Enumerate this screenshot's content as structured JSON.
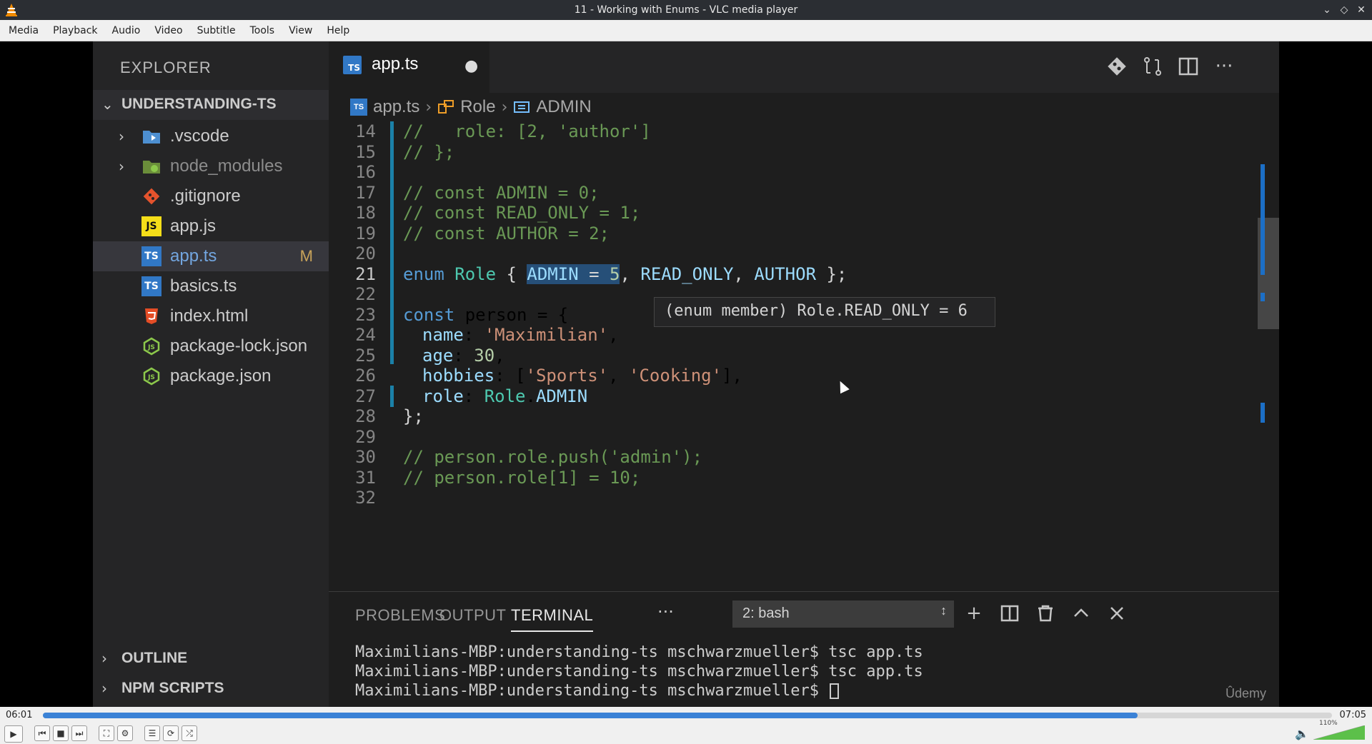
{
  "window": {
    "title": "11 - Working with Enums - VLC media player"
  },
  "menu": [
    "Media",
    "Playback",
    "Audio",
    "Video",
    "Subtitle",
    "Tools",
    "View",
    "Help"
  ],
  "explorer": {
    "title": "EXPLORER",
    "project": "UNDERSTANDING-TS",
    "items": [
      {
        "label": ".vscode",
        "icon": "vscode-folder-icon",
        "folder": true
      },
      {
        "label": "node_modules",
        "icon": "node-folder-icon",
        "folder": true
      },
      {
        "label": ".gitignore",
        "icon": "git-icon",
        "folder": false
      },
      {
        "label": "app.js",
        "icon": "js-icon",
        "folder": false
      },
      {
        "label": "app.ts",
        "icon": "ts-icon",
        "folder": false,
        "badge": "M"
      },
      {
        "label": "basics.ts",
        "icon": "ts-icon",
        "folder": false
      },
      {
        "label": "index.html",
        "icon": "html5-icon",
        "folder": false
      },
      {
        "label": "package-lock.json",
        "icon": "node-icon",
        "folder": false
      },
      {
        "label": "package.json",
        "icon": "node-icon",
        "folder": false
      }
    ],
    "outline": "OUTLINE",
    "npm_scripts": "NPM SCRIPTS"
  },
  "editor": {
    "tab": {
      "label": "app.ts",
      "icon_text": "TS"
    },
    "breadcrumb": [
      "app.ts",
      "Role",
      "ADMIN"
    ],
    "current_line": 21,
    "lines": [
      {
        "n": "14",
        "text": "//   role: [2, 'author']"
      },
      {
        "n": "15",
        "text": "// };"
      },
      {
        "n": "16",
        "text": ""
      },
      {
        "n": "17",
        "text": "// const ADMIN = 0;"
      },
      {
        "n": "18",
        "text": "// const READ_ONLY = 1;"
      },
      {
        "n": "19",
        "text": "// const AUTHOR = 2;"
      },
      {
        "n": "20",
        "text": ""
      },
      {
        "n": "21",
        "text": "enum Role { ADMIN = 5, READ_ONLY, AUTHOR };"
      },
      {
        "n": "22",
        "text": ""
      },
      {
        "n": "23",
        "text": "const person = {"
      },
      {
        "n": "24",
        "text": "name: 'Maximilian',"
      },
      {
        "n": "25",
        "text": "age: 30,"
      },
      {
        "n": "26",
        "text": "hobbies: ['Sports', 'Cooking'],"
      },
      {
        "n": "27",
        "text": "role: Role.ADMIN"
      },
      {
        "n": "28",
        "text": "};"
      },
      {
        "n": "29",
        "text": ""
      },
      {
        "n": "30",
        "text": "// person.role.push('admin');"
      },
      {
        "n": "31",
        "text": "// person.role[1] = 10;"
      },
      {
        "n": "32",
        "text": ""
      }
    ],
    "hover": "(enum member) Role.READ_ONLY = 6"
  },
  "panel": {
    "tabs": [
      "PROBLEMS",
      "OUTPUT",
      "TERMINAL"
    ],
    "active_tab": "TERMINAL",
    "terminal_select": "2: bash",
    "terminal_lines": [
      "Maximilians-MBP:understanding-ts mschwarzmueller$ tsc app.ts",
      "Maximilians-MBP:understanding-ts mschwarzmueller$ tsc app.ts",
      "Maximilians-MBP:understanding-ts mschwarzmueller$ "
    ],
    "watermark": "Ûdemy"
  },
  "player": {
    "elapsed": "06:01",
    "total": "07:05",
    "progress_fraction": 0.849,
    "volume_label": "110%",
    "volume_fraction": 1.0
  },
  "colors": {
    "accent": "#3b82d6",
    "ts": "#3178c6"
  }
}
